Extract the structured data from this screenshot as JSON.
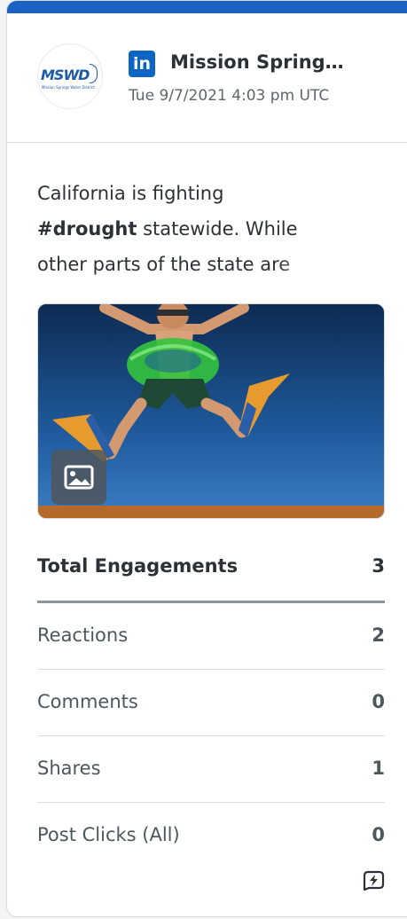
{
  "colors": {
    "accent": "#1a63c4",
    "linkedin": "#0a66c2"
  },
  "post": {
    "network_icon": "linkedin-icon",
    "avatar_text": "MSWD",
    "avatar_subtext": "Mission Springs Water District",
    "author": "Mission Spring…",
    "timestamp": "Tue 9/7/2021 4:03 pm UTC",
    "text_line1": "California is fighting",
    "hashtag": "#drought",
    "text_line2_rest": " statewide. While",
    "text_line3": "other parts of the state are",
    "media_icon": "image-icon"
  },
  "stats": {
    "total_label": "Total Engagements",
    "total_value": "3",
    "rows": [
      {
        "label": "Reactions",
        "value": "2"
      },
      {
        "label": "Comments",
        "value": "0"
      },
      {
        "label": "Shares",
        "value": "1"
      },
      {
        "label": "Post Clicks (All)",
        "value": "0"
      }
    ]
  },
  "footer": {
    "action_icon": "lightning-chat-icon"
  }
}
